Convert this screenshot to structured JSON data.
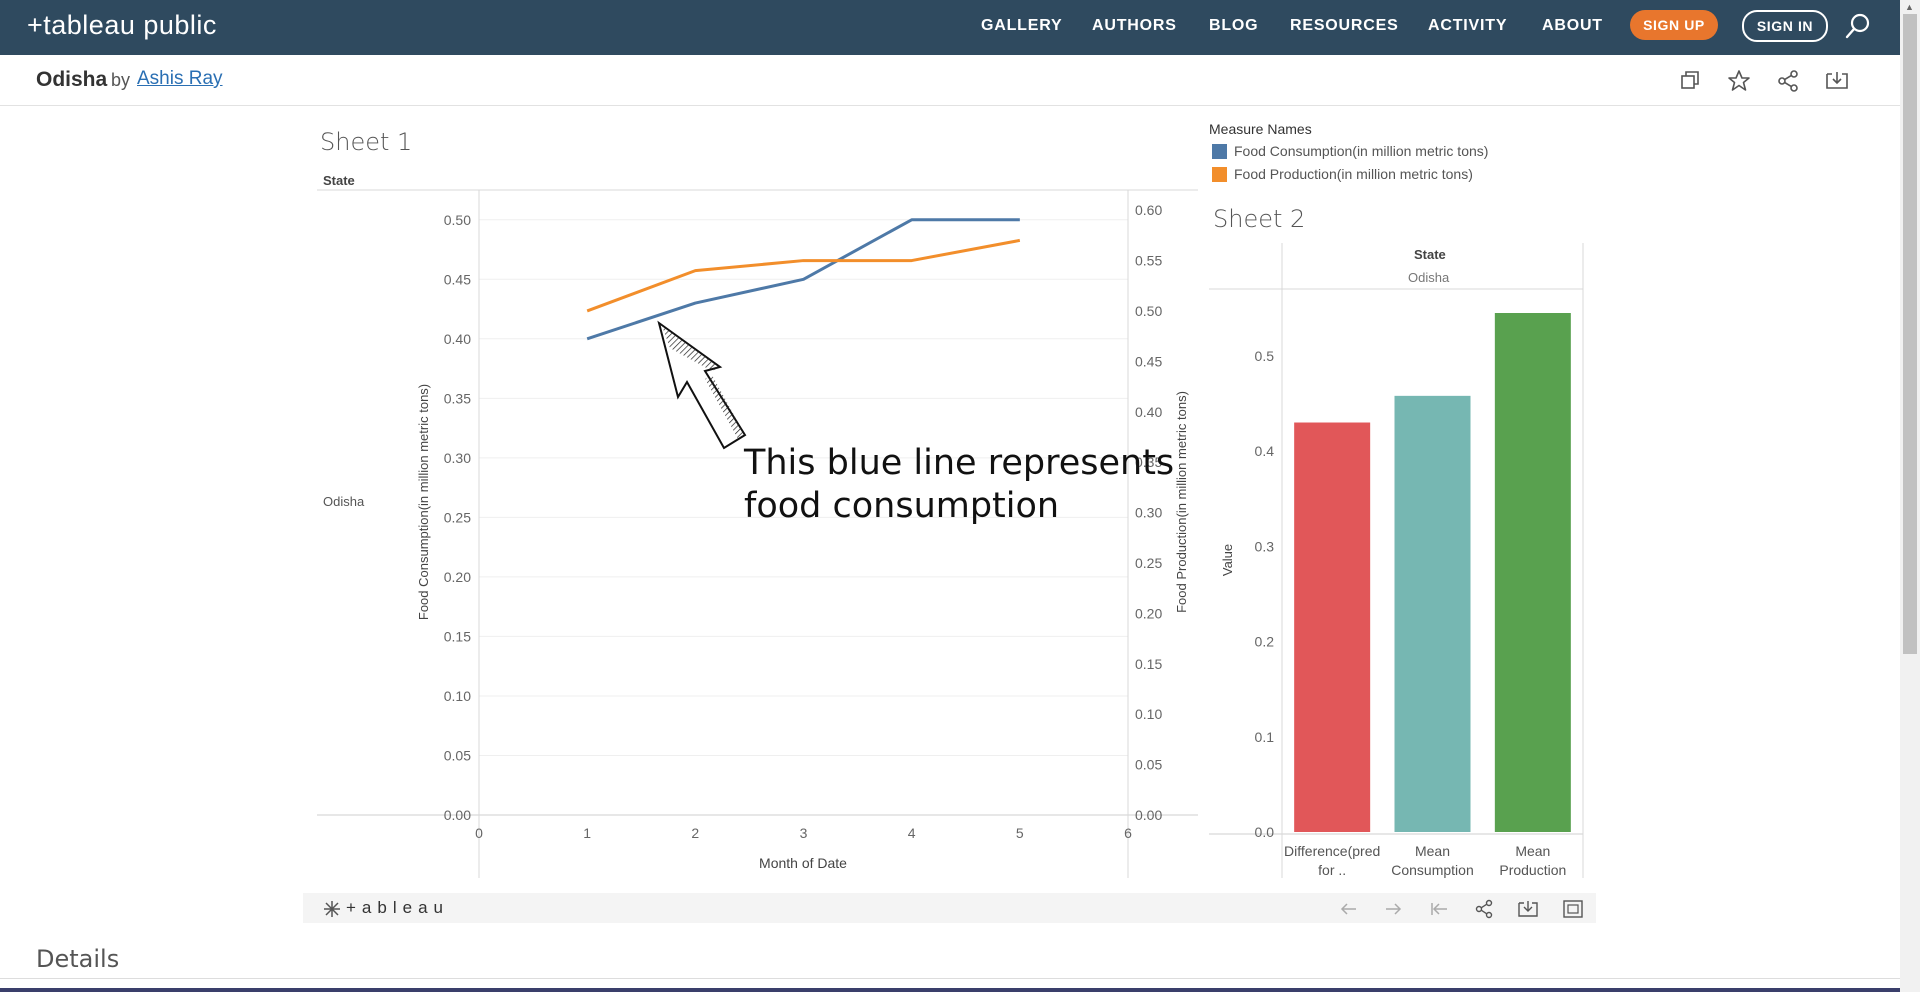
{
  "nav": {
    "logo": "+tableau public",
    "items": [
      "GALLERY",
      "AUTHORS",
      "BLOG",
      "RESOURCES",
      "ACTIVITY",
      "ABOUT"
    ],
    "signup": "SIGN UP",
    "signin": "SIGN IN",
    "bg_color": "#2f4a5f",
    "signup_color": "#e8762d"
  },
  "viz": {
    "title": "Odisha",
    "by": "by",
    "author": "Ashis Ray",
    "icons": [
      "copy-icon",
      "star-icon",
      "share-icon",
      "download-icon"
    ]
  },
  "sheet1": {
    "title": "Sheet 1",
    "row_header": "State",
    "row_value": "Odisha",
    "annotation_line1": "This blue line represents",
    "annotation_line2": "food consumption"
  },
  "legend": {
    "title": "Measure Names",
    "items": [
      {
        "label": "Food Consumption(in million metric tons)",
        "color": "#4e79a7"
      },
      {
        "label": "Food Production(in million metric tons)",
        "color": "#f28e2b"
      }
    ]
  },
  "sheet2": {
    "title": "Sheet 2",
    "col_header": "State",
    "col_value": "Odisha"
  },
  "toolbar": {
    "brand": "+ableau",
    "icons": [
      "undo-icon",
      "redo-icon",
      "revert-icon",
      "share-icon",
      "download-icon",
      "fullscreen-icon"
    ]
  },
  "details": "Details",
  "chart_data": [
    {
      "type": "line",
      "title": "Sheet 1",
      "xlabel": "Month of Date",
      "ylabel": "Food Consumption(in million metric tons)",
      "y2label": "Food Production(in million metric tons)",
      "x_ticks": [
        "0",
        "1",
        "2",
        "3",
        "4",
        "5",
        "6"
      ],
      "xlim": [
        0,
        6
      ],
      "y_ticks": [
        "0.00",
        "0.05",
        "0.10",
        "0.15",
        "0.20",
        "0.25",
        "0.30",
        "0.35",
        "0.40",
        "0.45",
        "0.50"
      ],
      "ylim": [
        0,
        0.525
      ],
      "y2_ticks": [
        "0.00",
        "0.05",
        "0.10",
        "0.15",
        "0.20",
        "0.25",
        "0.30",
        "0.35",
        "0.40",
        "0.45",
        "0.50",
        "0.55",
        "0.60"
      ],
      "y2lim": [
        0,
        0.62
      ],
      "series": [
        {
          "name": "Food Consumption(in million metric tons)",
          "axis": "left",
          "color": "#4e79a7",
          "x": [
            1,
            2,
            3,
            4,
            5
          ],
          "values": [
            0.4,
            0.43,
            0.45,
            0.5,
            0.5
          ]
        },
        {
          "name": "Food Production(in million metric tons)",
          "axis": "right",
          "color": "#f28e2b",
          "x": [
            1,
            2,
            3,
            4,
            5
          ],
          "values": [
            0.5,
            0.54,
            0.55,
            0.55,
            0.57
          ]
        }
      ]
    },
    {
      "type": "bar",
      "title": "Sheet 2",
      "ylabel": "Value",
      "categories": [
        "Difference(pred for ..",
        "Mean Consumption",
        "Mean Production"
      ],
      "category_lines": [
        [
          "Difference(pred",
          "for .."
        ],
        [
          "Mean",
          "Consumption"
        ],
        [
          "Mean",
          "Production"
        ]
      ],
      "values": [
        0.43,
        0.458,
        0.545
      ],
      "colors": [
        "#e15759",
        "#76b7b2",
        "#59a14f"
      ],
      "y_ticks": [
        "0.0",
        "0.1",
        "0.2",
        "0.3",
        "0.4",
        "0.5"
      ],
      "ylim": [
        0,
        0.545
      ]
    }
  ]
}
